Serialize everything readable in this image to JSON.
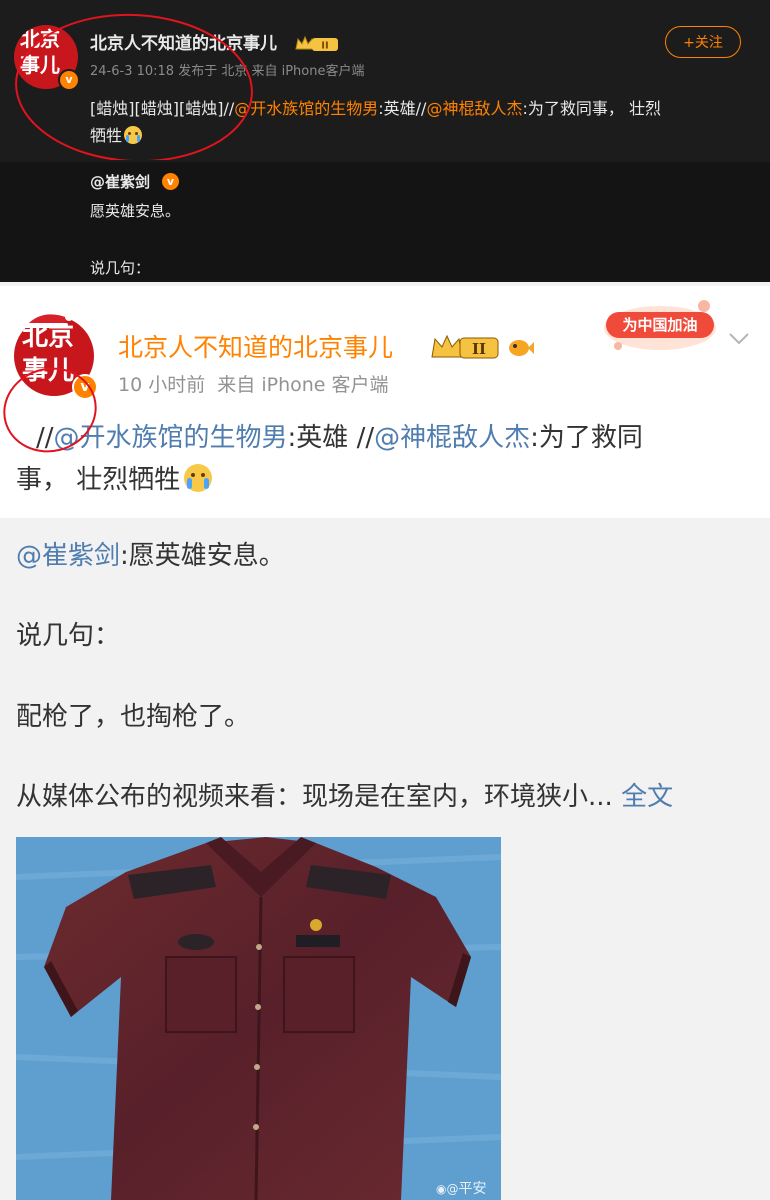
{
  "top_post": {
    "avatar_text_line1": "北京",
    "avatar_text_line2": "事儿",
    "username": "北京人不知道的北京事儿",
    "level_badge": "II",
    "meta": "24-6-3 10:18 发布于 北京 来自 iPhone客户端",
    "follow_label": "+关注",
    "content_prefix": "[蜡烛][蜡烛][蜡烛]//",
    "mention1": "@开水族馆的生物男",
    "content_mid": ":英雄//",
    "mention2": "@神棍敌人杰",
    "content_suffix_line1": ":为了救同事， 壮烈",
    "content_line2": "牺牲",
    "quote_author": "@崔紫剑",
    "quote_line1": "愿英雄安息。",
    "quote_line2": "说几句："
  },
  "bottom_post": {
    "avatar_text_line1": "北京",
    "avatar_text_line2": "事儿",
    "username": "北京人不知道的北京事儿",
    "level_badge": "II",
    "campaign_badge": "为中国加油",
    "meta": "10 小时前  来自 iPhone 客户端",
    "content_prefix": "//",
    "mention1": "@开水族馆的生物男",
    "content_mid": ":英雄 //",
    "mention2": "@神棍敌人杰",
    "content_suffix_line1": ":为了救同",
    "content_line2": "事， 壮烈牺牲",
    "quote_author": "@崔紫剑",
    "quote_text": ":愿英雄安息。",
    "quote_p2": "说几句：",
    "quote_p3": "配枪了，也掏枪了。",
    "quote_p4": "从媒体公布的视频来看：现场是在室内，环境狭小...",
    "full_text_link": "全文",
    "image_watermark": "平安"
  },
  "colors": {
    "accent_orange": "#ff8200",
    "link_blue": "#507daf",
    "annotation_red": "#e0141e",
    "dark_bg": "#1c1c1c"
  }
}
